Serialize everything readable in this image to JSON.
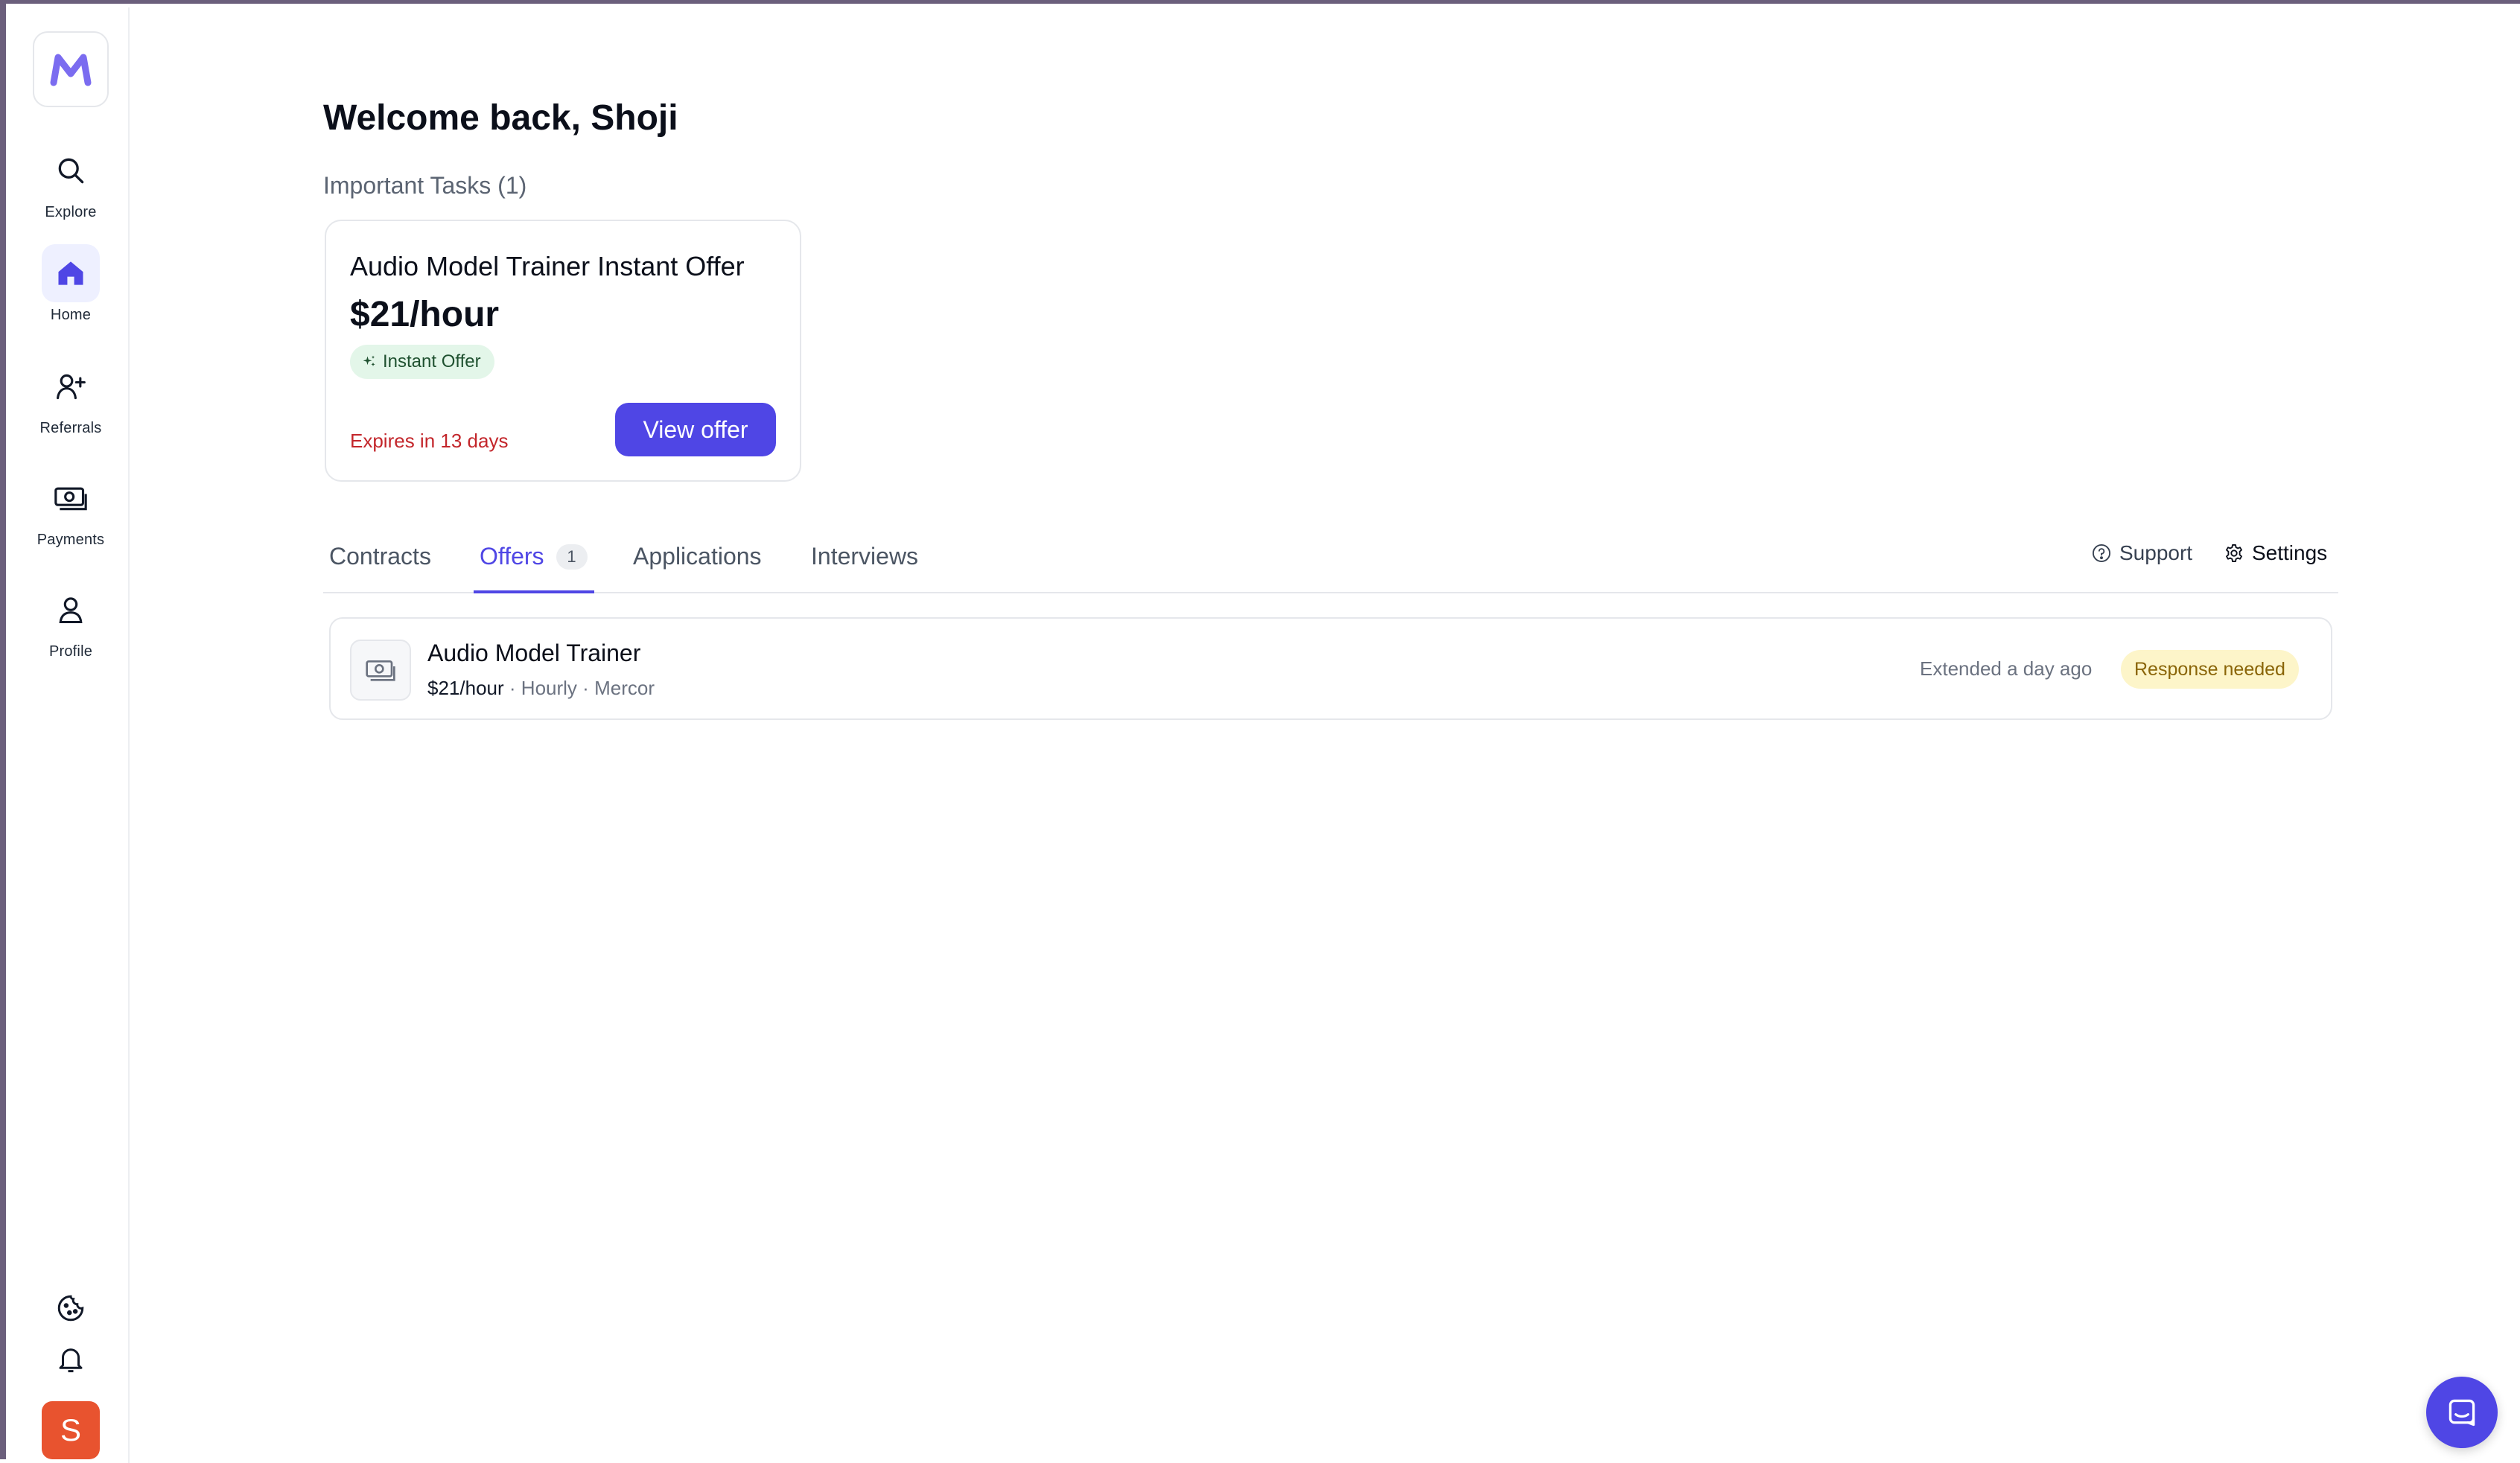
{
  "sidebar": {
    "logo_letter": "M",
    "items": [
      {
        "label": "Explore",
        "icon": "search-icon"
      },
      {
        "label": "Home",
        "icon": "home-icon",
        "active": true
      },
      {
        "label": "Referrals",
        "icon": "user-plus-icon"
      },
      {
        "label": "Payments",
        "icon": "money-icon"
      },
      {
        "label": "Profile",
        "icon": "user-icon"
      }
    ],
    "bottom_icons": [
      "cookie-icon",
      "bell-icon"
    ],
    "avatar_initial": "S",
    "avatar_color": "#e8532f"
  },
  "main": {
    "welcome": "Welcome back, Shoji",
    "important_tasks_heading": "Important Tasks (1)",
    "task_card": {
      "title": "Audio Model Trainer Instant Offer",
      "rate": "$21/hour",
      "badge": "Instant Offer",
      "expires": "Expires in 13 days",
      "button": "View offer"
    },
    "tabs": [
      {
        "label": "Contracts"
      },
      {
        "label": "Offers",
        "count": "1",
        "active": true
      },
      {
        "label": "Applications"
      },
      {
        "label": "Interviews"
      }
    ],
    "support_label": "Support",
    "settings_label": "Settings",
    "offer_row": {
      "title": "Audio Model Trainer",
      "rate": "$21/hour",
      "separator": "·",
      "type": "Hourly",
      "company": "Mercor",
      "extended": "Extended a day ago",
      "status": "Response needed"
    }
  },
  "colors": {
    "accent": "#4f46e5",
    "danger": "#c3262b",
    "success_bg": "#e3f6e9",
    "warning_bg": "#fdf5c9"
  }
}
